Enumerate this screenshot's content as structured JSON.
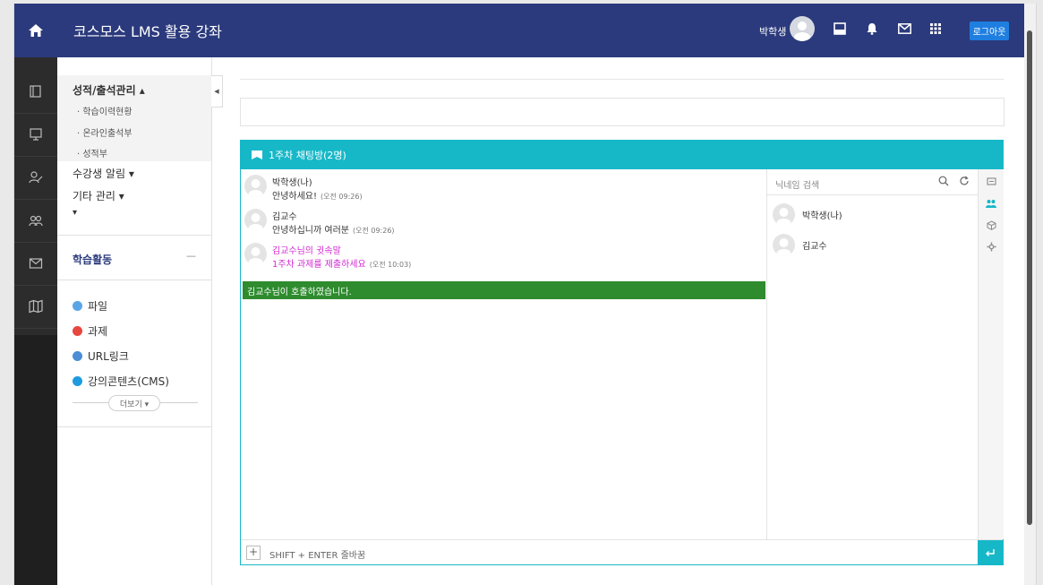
{
  "header": {
    "title": "코스모스 LMS 활용 강좌",
    "user_name": "박학생",
    "logout_label": "로그아웃"
  },
  "sidebar": {
    "grade_section": "성적/출석관리 ▴",
    "grade_items": [
      "· 학습이력현황",
      "· 온라인출석부",
      "· 성적부"
    ],
    "notice_item": "수강생 알림 ▾",
    "etc_item": "기타 관리 ▾",
    "extra_toggle": "▾",
    "activity_title": "학습활동",
    "activity_collapse": "—",
    "activities": [
      {
        "label": "파일",
        "color": "#5aa5e6"
      },
      {
        "label": "과제",
        "color": "#e8473f"
      },
      {
        "label": "URL링크",
        "color": "#4b8ed6"
      },
      {
        "label": "강의콘텐츠(CMS)",
        "color": "#1e9be0"
      }
    ],
    "more_label": "더보기 ▾"
  },
  "chat": {
    "room_title": "1주차 채팅방(2명)",
    "messages": [
      {
        "name": "박학생(나)",
        "text": "안녕하세요!",
        "time": "(오전 09:26)"
      },
      {
        "name": "김교수",
        "text": "안녕하십니까 여러분",
        "time": "(오전 09:26)"
      },
      {
        "name": "김교수님의 귓속말",
        "text": "1주차 과제를 제출하세요",
        "time": "(오전 10:03)"
      }
    ],
    "call_notice": "김교수님이 호출하였습니다.",
    "nick_search_placeholder": "닉네임 검색",
    "users": [
      "박학생(나)",
      "김교수"
    ],
    "input_placeholder": "SHIFT + ENTER 줄바꿈",
    "plus_label": "+"
  },
  "colors": {
    "header_bg": "#2b3a7c",
    "chat_accent": "#16b8c8",
    "call_bg": "#2e8b2e",
    "whisper": "#d12bd1",
    "logout_bg": "#1f7fe0"
  }
}
